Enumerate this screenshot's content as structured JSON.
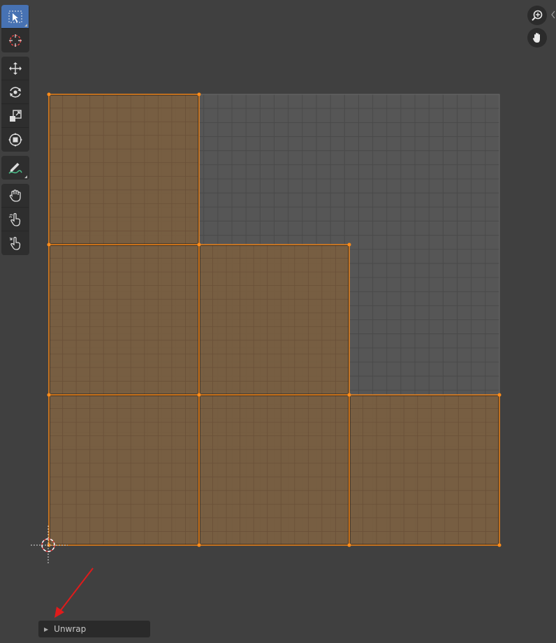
{
  "toolbar": {
    "groups": [
      [
        {
          "icon": "select-box-icon",
          "active": true
        },
        {
          "icon": "cursor-icon",
          "active": false
        }
      ],
      [
        {
          "icon": "move-icon"
        },
        {
          "icon": "rotate-icon"
        },
        {
          "icon": "scale-icon"
        },
        {
          "icon": "transform-icon"
        }
      ],
      [
        {
          "icon": "annotate-icon"
        }
      ],
      [
        {
          "icon": "grab-icon"
        },
        {
          "icon": "relax-icon"
        },
        {
          "icon": "pinch-icon"
        }
      ]
    ]
  },
  "navigation": {
    "zoom_icon": "zoom-icon",
    "pan_icon": "hand-pan-icon"
  },
  "uv_editor": {
    "colors": {
      "background": "#404040",
      "image_grid": "#565656",
      "face_fill": "#7a5e40",
      "edge": "#ff8c1a",
      "vertex": "#ff8c1a"
    },
    "faces_selected": 6
  },
  "operator_panel": {
    "label": "Unwrap",
    "expanded": false
  },
  "annotation": {
    "arrow_color": "#e01b1b"
  }
}
